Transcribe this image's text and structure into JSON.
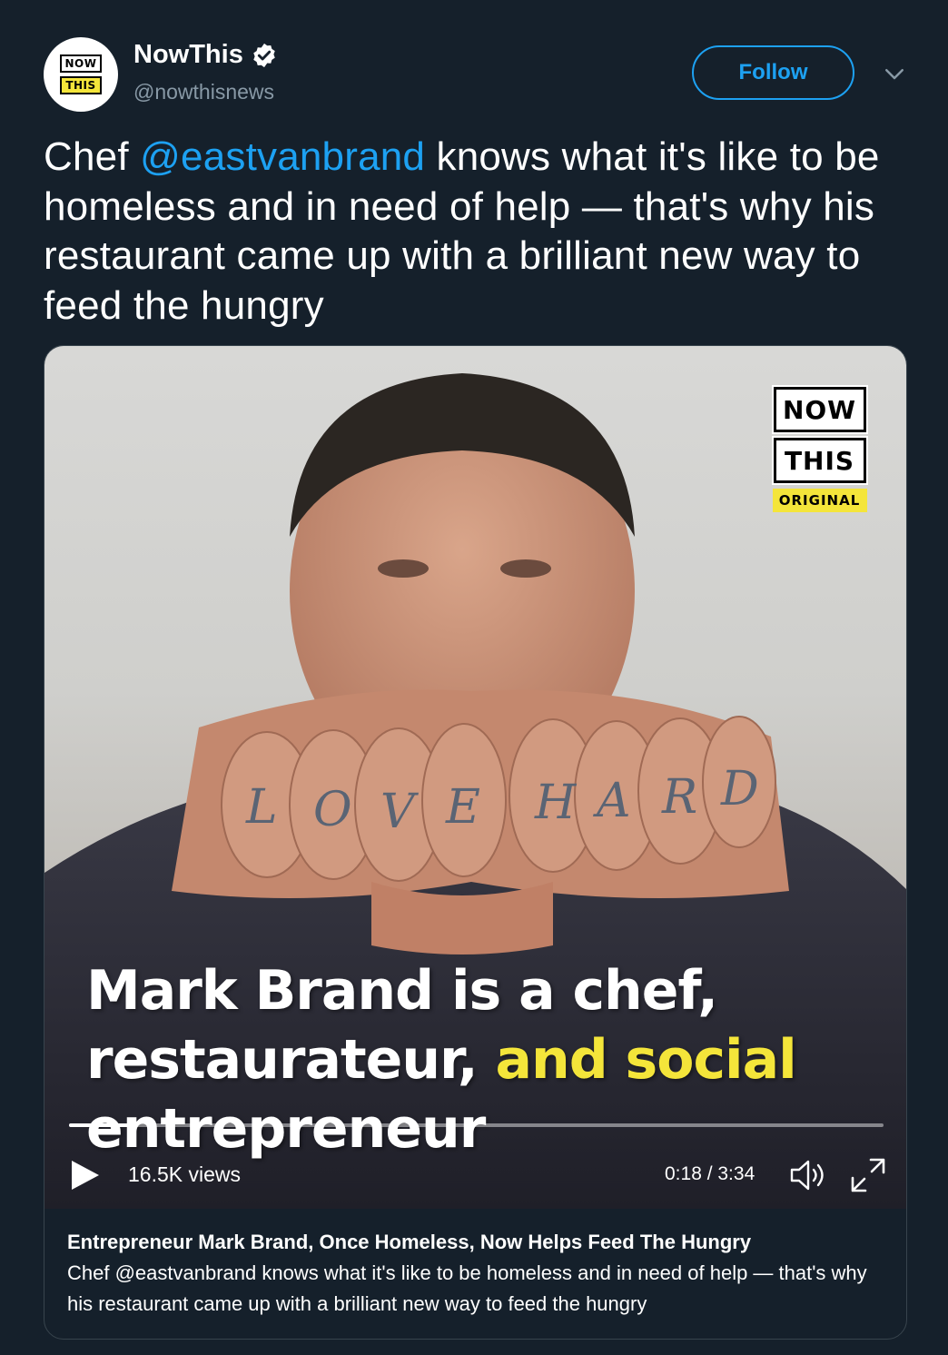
{
  "author": {
    "name": "NowThis",
    "handle": "@nowthisnews",
    "avatar_logo": {
      "top": "NOW",
      "bottom": "THIS"
    }
  },
  "actions": {
    "follow_label": "Follow"
  },
  "tweet": {
    "text_before": "Chef ",
    "mention": "@eastvanbrand",
    "text_after": "  knows what it's like to be homeless and in need of help — that's why his restaurant came up with a brilliant new way to feed the hungry"
  },
  "video": {
    "logo": {
      "line1": "NOW",
      "line2": "THIS",
      "tag": "ORIGINAL"
    },
    "caption": {
      "white1": "Mark Brand is a chef,",
      "white2": "restaurateur, ",
      "yellow": "and social",
      "white3": "entrepreneur"
    },
    "views": "16.5K views",
    "time": "0:18 / 3:34",
    "progress": 0.085
  },
  "card": {
    "title": "Entrepreneur Mark Brand, Once Homeless, Now Helps Feed The Hungry",
    "description": "Chef @eastvanbrand knows what it's like to be homeless and in need of help — that's why his restaurant came up with a brilliant new way to feed the hungry"
  },
  "colors": {
    "background": "#15202b",
    "accent": "#1da1f2",
    "muted": "#8899a6",
    "caption_highlight": "#f4e53a"
  },
  "icons": [
    "verified-icon",
    "chevron-down-icon",
    "play-icon",
    "volume-icon",
    "fullscreen-icon"
  ]
}
